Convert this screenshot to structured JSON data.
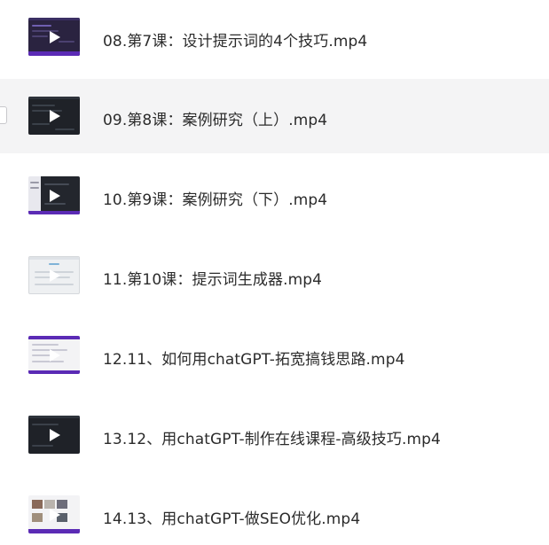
{
  "files": [
    {
      "name": "08.第7课：设计提示词的4个技巧.mp4",
      "thumb_theme": "purple",
      "icon": "play-icon"
    },
    {
      "name": "09.第8课：案例研究（上）.mp4",
      "thumb_theme": "dark",
      "icon": "play-icon",
      "hovered": true
    },
    {
      "name": "10.第9课：案例研究（下）.mp4",
      "thumb_theme": "mixed",
      "icon": "play-icon"
    },
    {
      "name": "11.第10课：提示词生成器.mp4",
      "thumb_theme": "light",
      "icon": "play-icon"
    },
    {
      "name": "12.11、如何用chatGPT-拓宽搞钱思路.mp4",
      "thumb_theme": "mixed",
      "icon": "play-icon"
    },
    {
      "name": "13.12、用chatGPT-制作在线课程-高级技巧.mp4",
      "thumb_theme": "dark",
      "icon": "play-icon"
    },
    {
      "name": "14.13、用chatGPT-做SEO优化.mp4",
      "thumb_theme": "mixed",
      "icon": "play-icon"
    }
  ],
  "colors": {
    "hover_row": "#f4f4f5",
    "text": "#2b2b2b",
    "accent_purple": "#5b2bb5"
  }
}
